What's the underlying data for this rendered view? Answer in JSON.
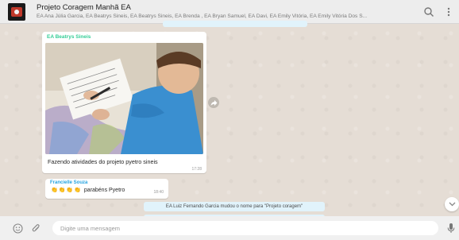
{
  "header": {
    "title": "Projeto Coragem Manhã EA",
    "members": "EA Ana Júlia Garcia, EA Beatrys Sineis, EA Beatrys Sineis, EA Brenda , EA Bryan Samuel, EA Davi, EA Emily Vitória, EA Emily Vitória Dos S...",
    "search_icon": "search-icon",
    "menu_icon": "kebab-menu-icon"
  },
  "messages": [
    {
      "sender": "EA Beatrys Sineis",
      "caption": "Fazendo atividades  do projeto  pyetro sineis",
      "time": "17:28",
      "sender_color": "#35cd96"
    },
    {
      "sender": "Francielle Souza",
      "text": "parabéns Pyetro",
      "claps": "👏👏👏👏",
      "time": "18:40",
      "sender_color": "#25a3e0"
    }
  ],
  "system_messages": [
    "EA Luiz Fernando Garcia mudou o nome para \"Projeto coragem\""
  ],
  "composer": {
    "placeholder": "Digite uma mensagem",
    "emoji_icon": "emoji-icon",
    "attach_icon": "paperclip-icon",
    "mic_icon": "microphone-icon"
  },
  "colors": {
    "header_bg": "#ededed",
    "chat_bg": "#e5ddd5",
    "system_bg": "#e1f3fb",
    "footer_bg": "#f0f0f0"
  }
}
